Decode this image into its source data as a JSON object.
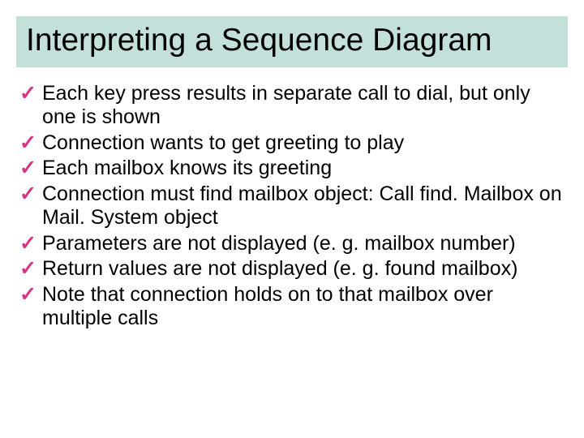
{
  "slide": {
    "title": "Interpreting a Sequence Diagram",
    "bullets": [
      "Each key press results in separate call to dial, but only one is shown",
      "Connection wants to get greeting to play",
      "Each mailbox knows its greeting",
      "Connection must find mailbox object: Call find. Mailbox on Mail. System object",
      "Parameters are not displayed (e. g. mailbox number)",
      "Return values are not displayed (e. g. found mailbox)",
      "Note that connection holds on to that mailbox over multiple calls"
    ],
    "bullet_glyph": "✓"
  }
}
